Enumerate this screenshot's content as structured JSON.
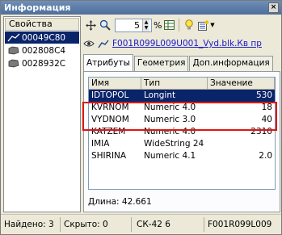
{
  "window": {
    "title": "Информация",
    "close_glyph": "×"
  },
  "left_panel": {
    "header": "Свойства",
    "objects": [
      {
        "label": "00049C80",
        "icon": "line-icon",
        "selected": true
      },
      {
        "label": "002808C4",
        "icon": "polygon-icon",
        "selected": false
      },
      {
        "label": "0028932C",
        "icon": "polygon-icon",
        "selected": false
      }
    ]
  },
  "toolbar": {
    "zoom_value": "5",
    "percent_label": "%"
  },
  "object": {
    "link_text": "F001R099L009U001_Vyd.blk.Кв пр"
  },
  "tabs": [
    {
      "label": "Атрибуты",
      "active": true
    },
    {
      "label": "Геометрия",
      "active": false
    },
    {
      "label": "Доп.информация",
      "active": false
    }
  ],
  "grid": {
    "columns": [
      "Имя",
      "Тип",
      "Значение"
    ],
    "rows": [
      [
        "IDTOPOL",
        "Longint",
        "530"
      ],
      [
        "KVRNOM",
        "Numeric 4.0",
        "18"
      ],
      [
        "VYDNOM",
        "Numeric 3.0",
        "40"
      ],
      [
        "KATZEM",
        "Numeric 4.0",
        "2310"
      ],
      [
        "IMIA",
        "WideString 24",
        ""
      ],
      [
        "SHIRINA",
        "Numeric 4.1",
        "2.0"
      ]
    ]
  },
  "length_label": "Длина: 42.661",
  "status": {
    "found": "Найдено: 3",
    "hidden": "Скрыто: 0",
    "crs": "СК-42 6",
    "file": "F001R099L009"
  },
  "colors": {
    "selection": "#0a246a",
    "highlight": "#e01414",
    "link": "#1a1acc"
  }
}
